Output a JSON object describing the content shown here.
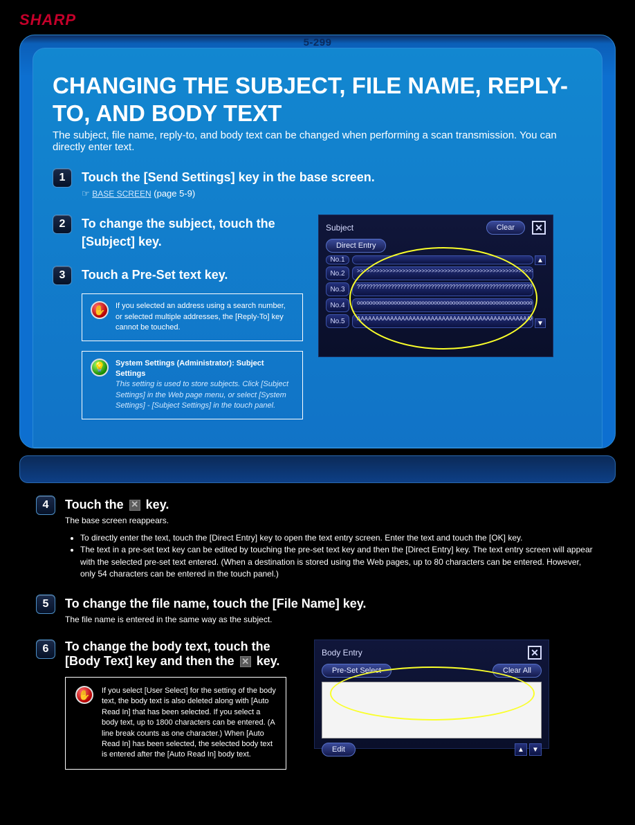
{
  "brand": "SHARP",
  "header_meta": "5-299",
  "page_title": "CHANGING THE SUBJECT, FILE NAME, REPLY-TO, AND BODY TEXT",
  "page_subtitle": "The subject, file name, reply-to, and body text can be changed when performing a scan transmission. You can directly enter text.",
  "steps": {
    "1": {
      "head": "Touch the [Send Settings] key in the base screen.",
      "link_text": "BASE SCREEN",
      "page_ref": "(page 5-9)"
    },
    "2": {
      "head": "To change the subject, touch the [Subject] key."
    },
    "3": {
      "head": "Touch a Pre-Set text key.",
      "warn": "If you selected an address using a search number, or selected multiple addresses, the [Reply-To] key cannot be touched.",
      "tip_head": "System Settings (Administrator): Subject Settings",
      "tip_body": "This setting is used to store subjects. Click [Subject Settings] in the Web page menu, or select [System Settings] - [Subject Settings] in the touch panel."
    },
    "4": {
      "head_prefix": "Touch the  ",
      "head_suffix": "  key.",
      "sub": "The base screen reappears.",
      "bullet1": "To directly enter the text, touch the [Direct Entry] key to open the text entry screen. Enter the text and touch the [OK] key.",
      "bullet2": "The text in a pre-set text key can be edited by touching the pre-set text key and then the [Direct Entry] key. The text entry screen will appear with the selected pre-set text entered. (When a destination is stored using the Web pages, up to 80 characters can be entered. However, only 54 characters can be entered in the touch panel.)"
    },
    "5": {
      "head": "To change the file name, touch the [File Name] key.",
      "sub": "The file name is entered in the same way as the subject."
    },
    "6": {
      "head_prefix": "To change the body text, touch the [Body Text] key and then the  ",
      "head_suffix": "  key.",
      "warn": "If you select [User Select] for the setting of the body text, the body text is also deleted along with [Auto Read In] that has been selected. If you select a body text, up to 1800 characters can be entered. (A line break counts as one character.) When [Auto Read In] has been selected, the selected body text is entered after the [Auto Read In] body text."
    }
  },
  "subject_shot": {
    "title": "Subject",
    "clear": "Clear",
    "direct_entry": "Direct Entry",
    "rows": [
      {
        "num": "No.1",
        "txt": ""
      },
      {
        "num": "No.2",
        "txt": ">>>>>>>>>>>>>>>>>>>>>>>>>>>>>>>>>>>>>>>>>>>>>>>>>>>>>>>>>>>>>>>>>>>>>>>>"
      },
      {
        "num": "No.3",
        "txt": "????????????????????????????????????????????????????????????????"
      },
      {
        "num": "No.4",
        "txt": "oooooooooooooooooooooooooooooooooooooooooooooooooooooooooooooooooooo"
      },
      {
        "num": "No.5",
        "txt": "AAAAAAAAAAAAAAAAAAAAAAAAAAAAAAAAAAAAAAAAAAAAAAAAAAAAAAAAAAA"
      }
    ]
  },
  "bodyentry_shot": {
    "title": "Body Entry",
    "preset": "Pre-Set Select",
    "clear_all": "Clear All",
    "edit": "Edit"
  }
}
